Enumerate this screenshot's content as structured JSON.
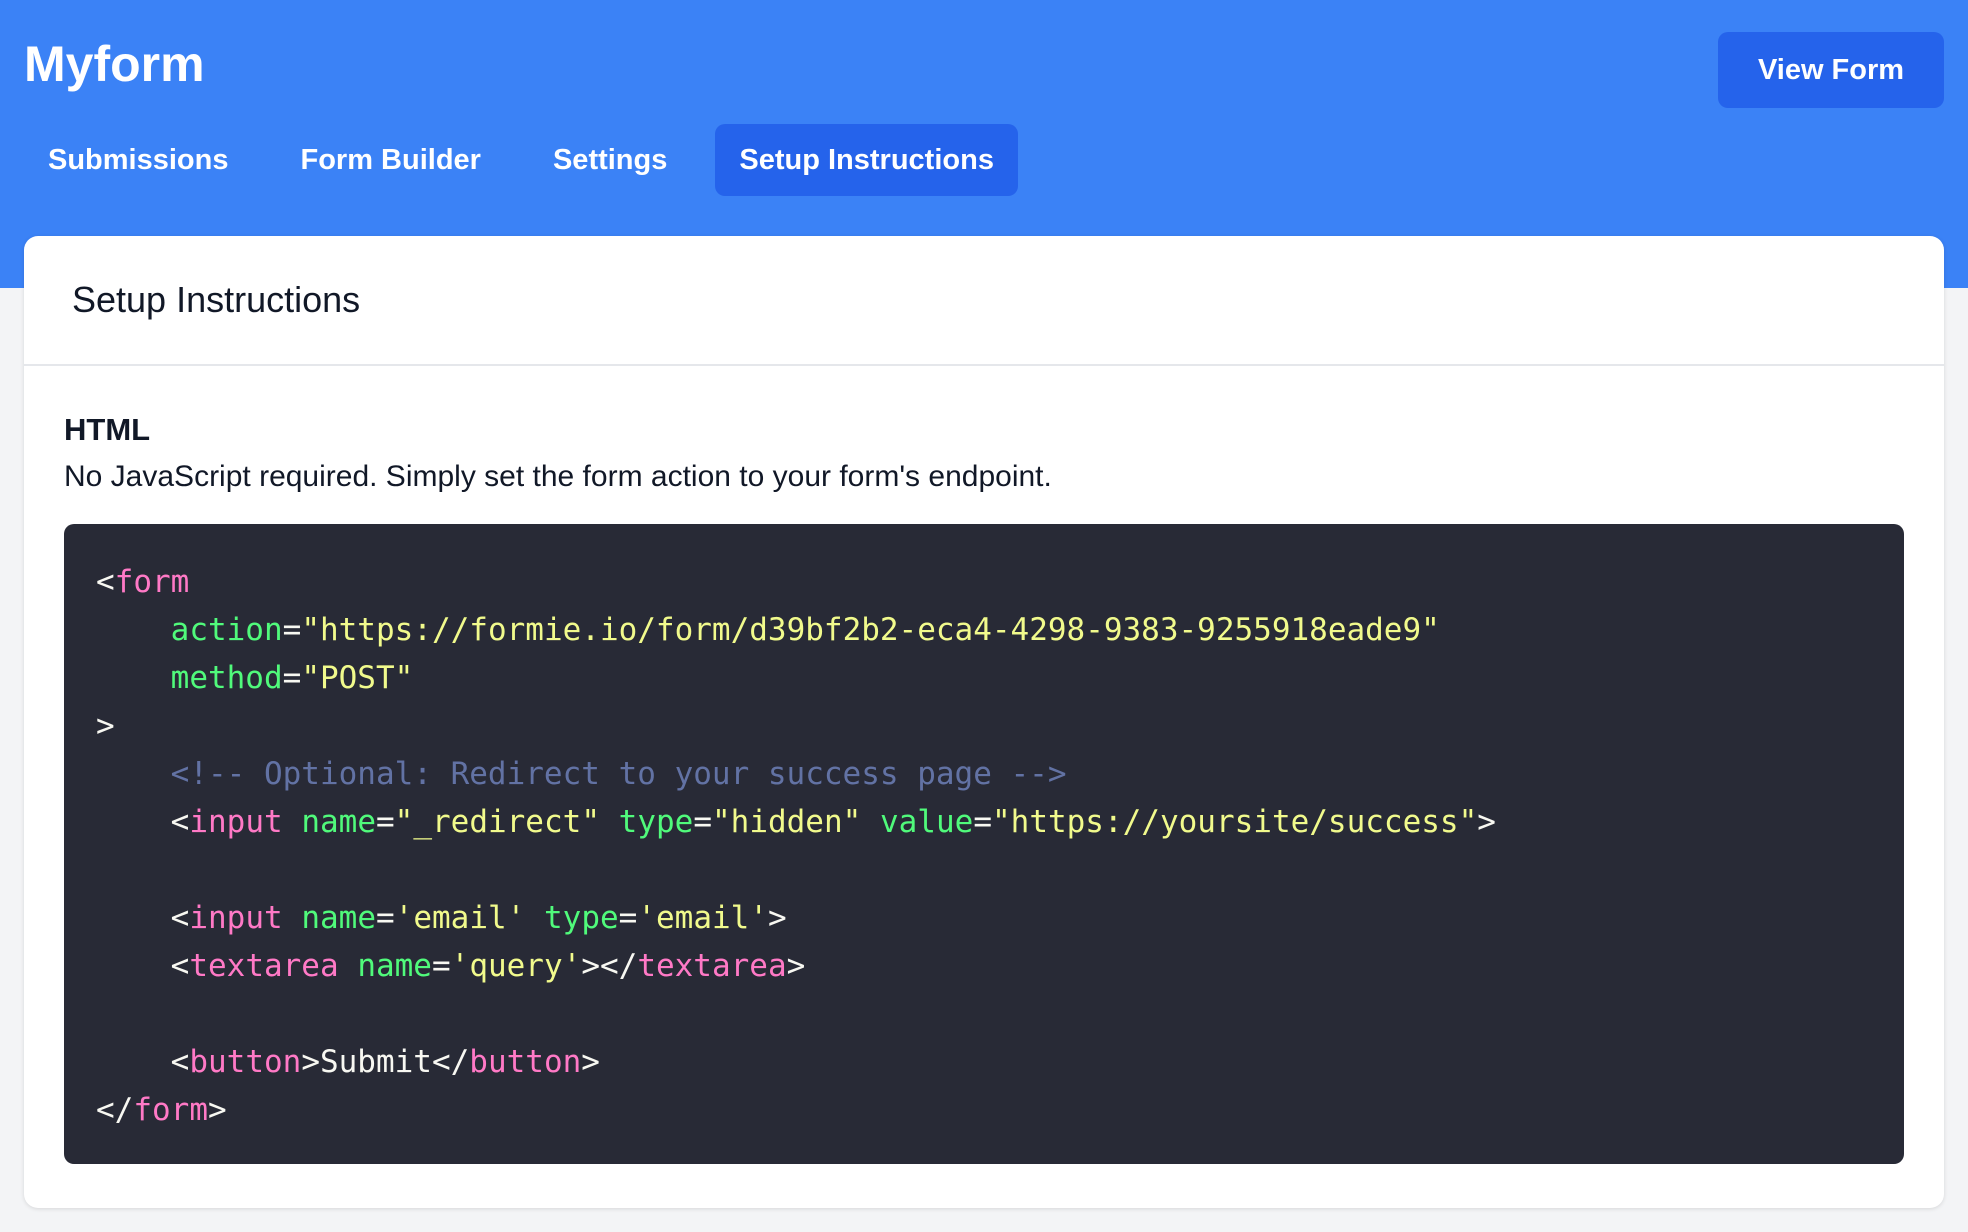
{
  "app": {
    "title": "Myform"
  },
  "header": {
    "view_form_label": "View Form"
  },
  "tabs": [
    {
      "label": "Submissions",
      "active": false
    },
    {
      "label": "Form Builder",
      "active": false
    },
    {
      "label": "Settings",
      "active": false
    },
    {
      "label": "Setup Instructions",
      "active": true
    }
  ],
  "card": {
    "title": "Setup Instructions",
    "section_title": "HTML",
    "section_description": "No JavaScript required. Simply set the form action to your form's endpoint."
  },
  "code": {
    "endpoint_url": "https://formie.io/form/d39bf2b2-eca4-4298-9383-9255918eade9",
    "method": "POST",
    "comment": "<!-- Optional: Redirect to your success page -->",
    "redirect_name": "_redirect",
    "redirect_type": "hidden",
    "redirect_value": "https://yoursite/success",
    "email_name": "email",
    "email_type": "email",
    "textarea_name": "query",
    "button_text": "Submit"
  },
  "colors": {
    "header": "#3b82f6",
    "accent": "#2563eb",
    "code_bg": "#282a36",
    "code_tag": "#ff79c6",
    "code_attr": "#50fa7b",
    "code_string": "#f1fa8c",
    "code_comment": "#6272a4"
  }
}
